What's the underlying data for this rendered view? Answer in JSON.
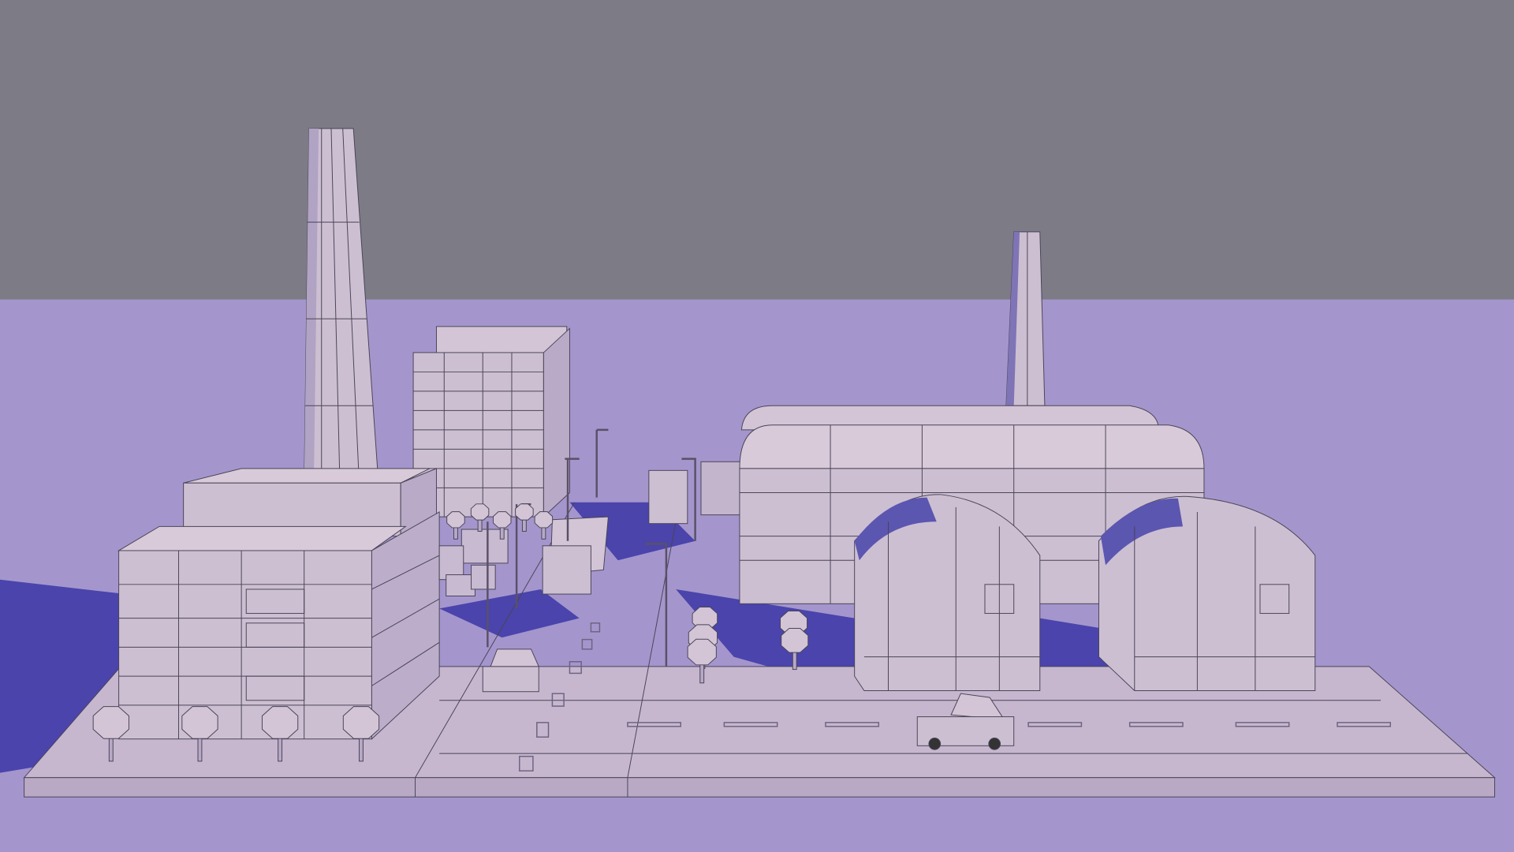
{
  "scene": {
    "colors": {
      "sky": "#7d7b86",
      "ground": "#a496cc",
      "building": "#cdbfd2",
      "building_side": "#b9abc8",
      "roof": "#d8cad8",
      "shadow": "#3b36a6",
      "glass": "#5b56b0",
      "wire": "#4a4458"
    },
    "objects": [
      "smokestack-left",
      "smokestack-right",
      "factory-building",
      "office-tower",
      "warehouse",
      "hangar-left",
      "hangar-right",
      "trees",
      "street-lamps",
      "cars",
      "truck",
      "road-platform"
    ]
  }
}
